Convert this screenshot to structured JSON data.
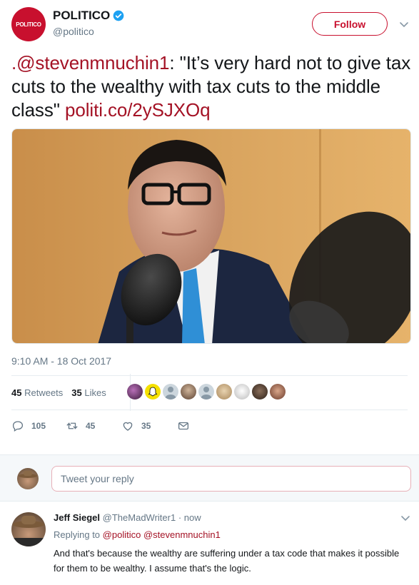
{
  "tweet": {
    "author_name": "POLITICO",
    "author_handle": "@politico",
    "avatar_text": "POLITICO",
    "follow_label": "Follow",
    "text_prefix": ".@stevenmnuchin1",
    "text_body": ": \"It’s very hard not to give tax cuts to the wealthy with tax cuts to the middle class\" ",
    "link": "politi.co/2ySJXOq",
    "timestamp": "9:10 AM - 18 Oct 2017",
    "retweets_count": "45",
    "retweets_label": "Retweets",
    "likes_count": "35",
    "likes_label": "Likes",
    "replies_action": "105",
    "retweets_action": "45",
    "likes_action": "35"
  },
  "reply_box": {
    "placeholder": "Tweet your reply"
  },
  "reply": {
    "name": "Jeff Siegel",
    "handle": "@TheMadWriter1",
    "time": "· now",
    "replying_label": "Replying to ",
    "replying_to_1": "@politico",
    "replying_to_2": "@stevenmnuchin1",
    "body": "And that's because the wealthy are suffering under a tax code that makes it possible for them to be wealthy. I assume that's the logic."
  },
  "colors": {
    "brand_red": "#c8102e",
    "link_red": "#a41225",
    "muted": "#657786",
    "verified_blue": "#1da1f2"
  }
}
